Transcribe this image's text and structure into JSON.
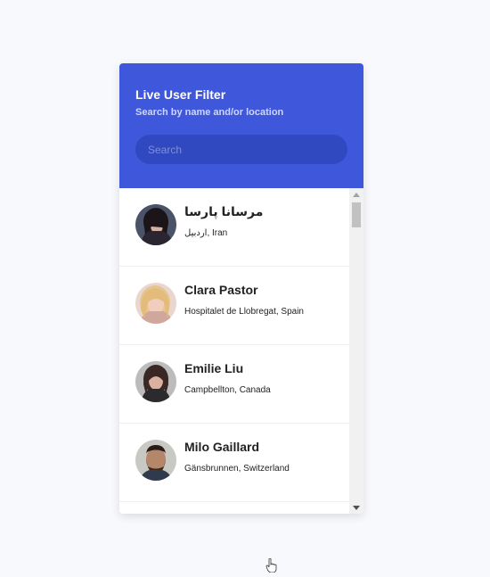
{
  "header": {
    "title": "Live User Filter",
    "subtitle": "Search by name and/or location"
  },
  "search": {
    "placeholder": "Search",
    "value": ""
  },
  "users": [
    {
      "name": "مرسانا پارسا",
      "location": "اردبیل, Iran",
      "avatar_icon": "avatar-photo-woman-dark-hair"
    },
    {
      "name": "Clara Pastor",
      "location": "Hospitalet de Llobregat, Spain",
      "avatar_icon": "avatar-photo-woman-blonde"
    },
    {
      "name": "Emilie Liu",
      "location": "Campbellton, Canada",
      "avatar_icon": "avatar-photo-woman-brown-hair"
    },
    {
      "name": "Milo Gaillard",
      "location": "Gänsbrunnen, Switzerland",
      "avatar_icon": "avatar-photo-man-beard"
    }
  ],
  "colors": {
    "accent": "#3e57db",
    "search_bg": "#3149c0",
    "page_bg": "#f8f9fd"
  }
}
